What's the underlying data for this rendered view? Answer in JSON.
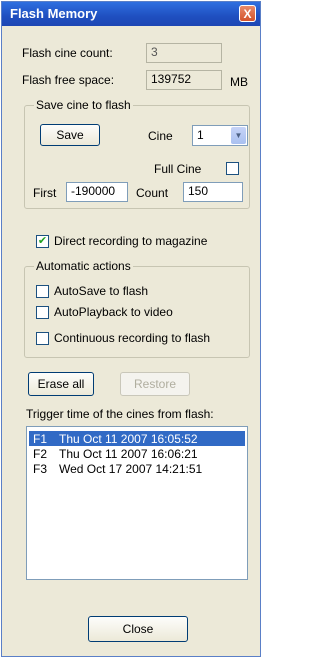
{
  "window": {
    "title": "Flash Memory",
    "close_glyph": "X"
  },
  "info": {
    "cine_count_label": "Flash cine count:",
    "cine_count_value": "3",
    "free_space_label": "Flash free space:",
    "free_space_value": "139752",
    "free_space_unit": "MB"
  },
  "save_group": {
    "title": "Save cine to flash",
    "save_button": "Save",
    "cine_label": "Cine",
    "cine_selected": "1",
    "full_cine_label": "Full Cine",
    "full_cine_checked": false,
    "first_label": "First",
    "first_value": "-190000",
    "count_label": "Count",
    "count_value": "150"
  },
  "direct_recording": {
    "label": "Direct recording to magazine",
    "checked": true,
    "check_glyph": "✔"
  },
  "auto_group": {
    "title": "Automatic actions",
    "options": [
      {
        "label": "AutoSave to flash",
        "checked": false
      },
      {
        "label": "AutoPlayback to video",
        "checked": false
      },
      {
        "label": "Continuous recording to flash",
        "checked": false
      }
    ]
  },
  "actions": {
    "erase_all": "Erase all",
    "restore": "Restore"
  },
  "trigger_list": {
    "label": "Trigger time of the cines from flash:",
    "items": [
      {
        "id": "F1",
        "time": "Thu Oct 11 2007 16:05:52",
        "selected": true
      },
      {
        "id": "F2",
        "time": "Thu Oct 11 2007 16:06:21",
        "selected": false
      },
      {
        "id": "F3",
        "time": "Wed Oct 17 2007 14:21:51",
        "selected": false
      }
    ]
  },
  "footer": {
    "close_button": "Close"
  }
}
